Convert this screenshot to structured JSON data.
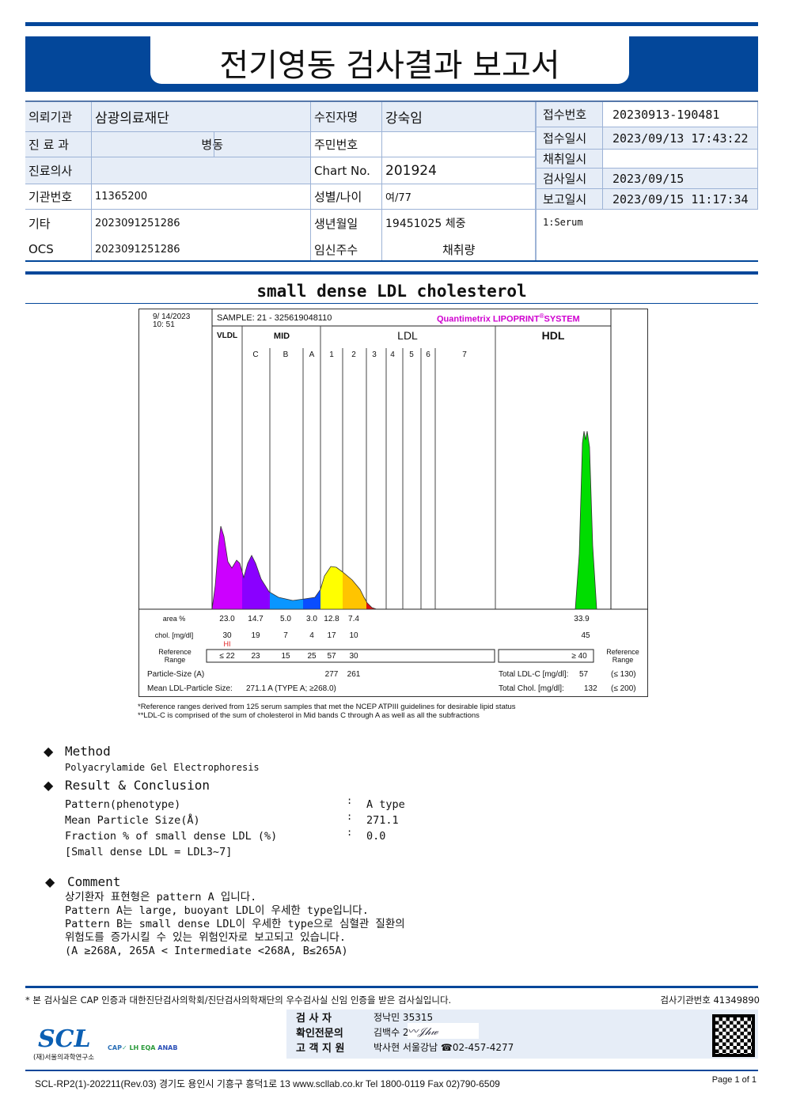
{
  "title": "전기영동 검사결과 보고서",
  "info_left": [
    [
      {
        "l": "의뢰기관",
        "v": "삼광의료재단"
      },
      {
        "l": "수진자명",
        "v": "강숙임"
      }
    ],
    [
      {
        "l": "진 료 과",
        "v": "병동"
      },
      {
        "l": "주민번호",
        "v": ""
      }
    ],
    [
      {
        "l": "진료의사",
        "v": ""
      },
      {
        "l": "Chart No.",
        "v": "201924"
      }
    ],
    [
      {
        "l": "기관번호",
        "v": "11365200"
      },
      {
        "l": "성별/나이",
        "v": "여/77"
      }
    ],
    [
      {
        "l": "기타",
        "v": "2023091251286"
      },
      {
        "l": "생년월일",
        "v": "19451025 체중"
      }
    ],
    [
      {
        "l": "OCS",
        "v": "2023091251286"
      },
      {
        "l": "임신주수",
        "v": "채취량"
      }
    ]
  ],
  "info_right": [
    {
      "l": "접수번호",
      "v": "20230913-190481"
    },
    {
      "l": "접수일시",
      "v": "2023/09/13 17:43:22"
    },
    {
      "l": "채취일시",
      "v": ""
    },
    {
      "l": "검사일시",
      "v": "2023/09/15"
    },
    {
      "l": "보고일시",
      "v": "2023/09/15 11:17:34"
    }
  ],
  "specimen": "1:Serum",
  "section_title": "small dense LDL cholesterol",
  "chart_data": {
    "type": "area",
    "datetime": "9/ 14/2023\n10: 51",
    "sample": "SAMPLE:   21 - 325619048110",
    "brand": "Quantimetrix LIPOPRINT",
    "brand_suffix": "SYSTEM",
    "groups": [
      "VLDL",
      "MID",
      "LDL",
      "HDL"
    ],
    "bands": [
      "C",
      "B",
      "A",
      "1",
      "2",
      "3",
      "4",
      "5",
      "6",
      "7"
    ],
    "colors": {
      "VLDL": "#cc00ff",
      "C": "#8a00ff",
      "B": "#0a96ff",
      "A": "#0a4dff",
      "1": "#ffff00",
      "2": "#ffc400",
      "3": "#e01010",
      "HDL": "#00dd00"
    },
    "rows": {
      "area_label": "area %",
      "area": [
        "23.0",
        "14.7",
        "5.0",
        "3.0",
        "12.8",
        "7.4"
      ],
      "area_hdl": "33.9",
      "chol_label": "chol. [mg/dl]",
      "chol": [
        "30",
        "19",
        "7",
        "4",
        "17",
        "10"
      ],
      "chol_hdl": "45",
      "flag": "HI",
      "ref_label": "Reference Range",
      "ref": [
        "≤ 22",
        "23",
        "15",
        "25",
        "57",
        "30"
      ],
      "ref_hdl": "≥  40",
      "ref_label_right": "Reference Range",
      "psize_label": "Particle-Size (A)",
      "psize": [
        "277",
        "261"
      ],
      "mean_label": "Mean LDL-Particle Size:",
      "mean_value": "271.1  A   (TYPE A; ≥268.0)",
      "total_ldl_label": "Total LDL-C [mg/dl]:",
      "total_ldl": "57",
      "total_ldl_ref": "(≤ 130)",
      "total_chol_label": "Total Chol. [mg/dl]:",
      "total_chol": "132",
      "total_chol_ref": "(≤ 200)"
    },
    "notes": [
      "*Reference ranges derived from 125 serum samples that met the NCEP ATPIII guidelines for desirable lipid status",
      "**LDL-C is comprised of the sum of cholesterol in Mid bands C through A as well as all the subfractions"
    ]
  },
  "method": {
    "heading": "Method",
    "text": "Polyacrylamide Gel Electrophoresis"
  },
  "result": {
    "heading": "Result & Conclusion",
    "rows": [
      {
        "l": "Pattern(phenotype)",
        "v": "A type"
      },
      {
        "l": "Mean Particle Size(Å)",
        "v": "271.1"
      },
      {
        "l": "Fraction % of small dense LDL (%)",
        "v": "0.0"
      }
    ],
    "note": "[Small dense LDL = LDL3~7]"
  },
  "comment": {
    "heading": "Comment",
    "lines": [
      "상기환자 표현형은 pattern A 입니다.",
      "Pattern A는 large, buoyant LDL이 우세한 type입니다.",
      "Pattern B는 small dense LDL이 우세한 type으로 심혈관 질환의",
      "위험도를 증가시킬 수 있는 위험인자로 보고되고 있습니다.",
      "(A ≥268A, 265A < Intermediate <268A, B≤265A)"
    ]
  },
  "footer": {
    "cert": "* 본 검사실은 CAP 인증과 대한진단검사의학회/진단검사의학재단의 우수검사실 신임 인증을 받은 검사실입니다.",
    "inst_no": "검사기관번호 41349890",
    "staff": [
      {
        "l": "검   사   자",
        "v": "정낙민 35315"
      },
      {
        "l": "확인전문의",
        "v": "김백수 240"
      },
      {
        "l": "고 객 지 원",
        "v": "박사현 서울강남 ☎02-457-4277"
      }
    ],
    "logo": "SCL",
    "logo_sub": "(재)서울의과학연구소",
    "address": "SCL-RP2(1)-202211(Rev.03)  경기도 용인시 기흥구 흥덕1로 13  www.scllab.co.kr   Tel 1800-0119    Fax 02)790-6509",
    "page": "Page 1 of 1"
  }
}
